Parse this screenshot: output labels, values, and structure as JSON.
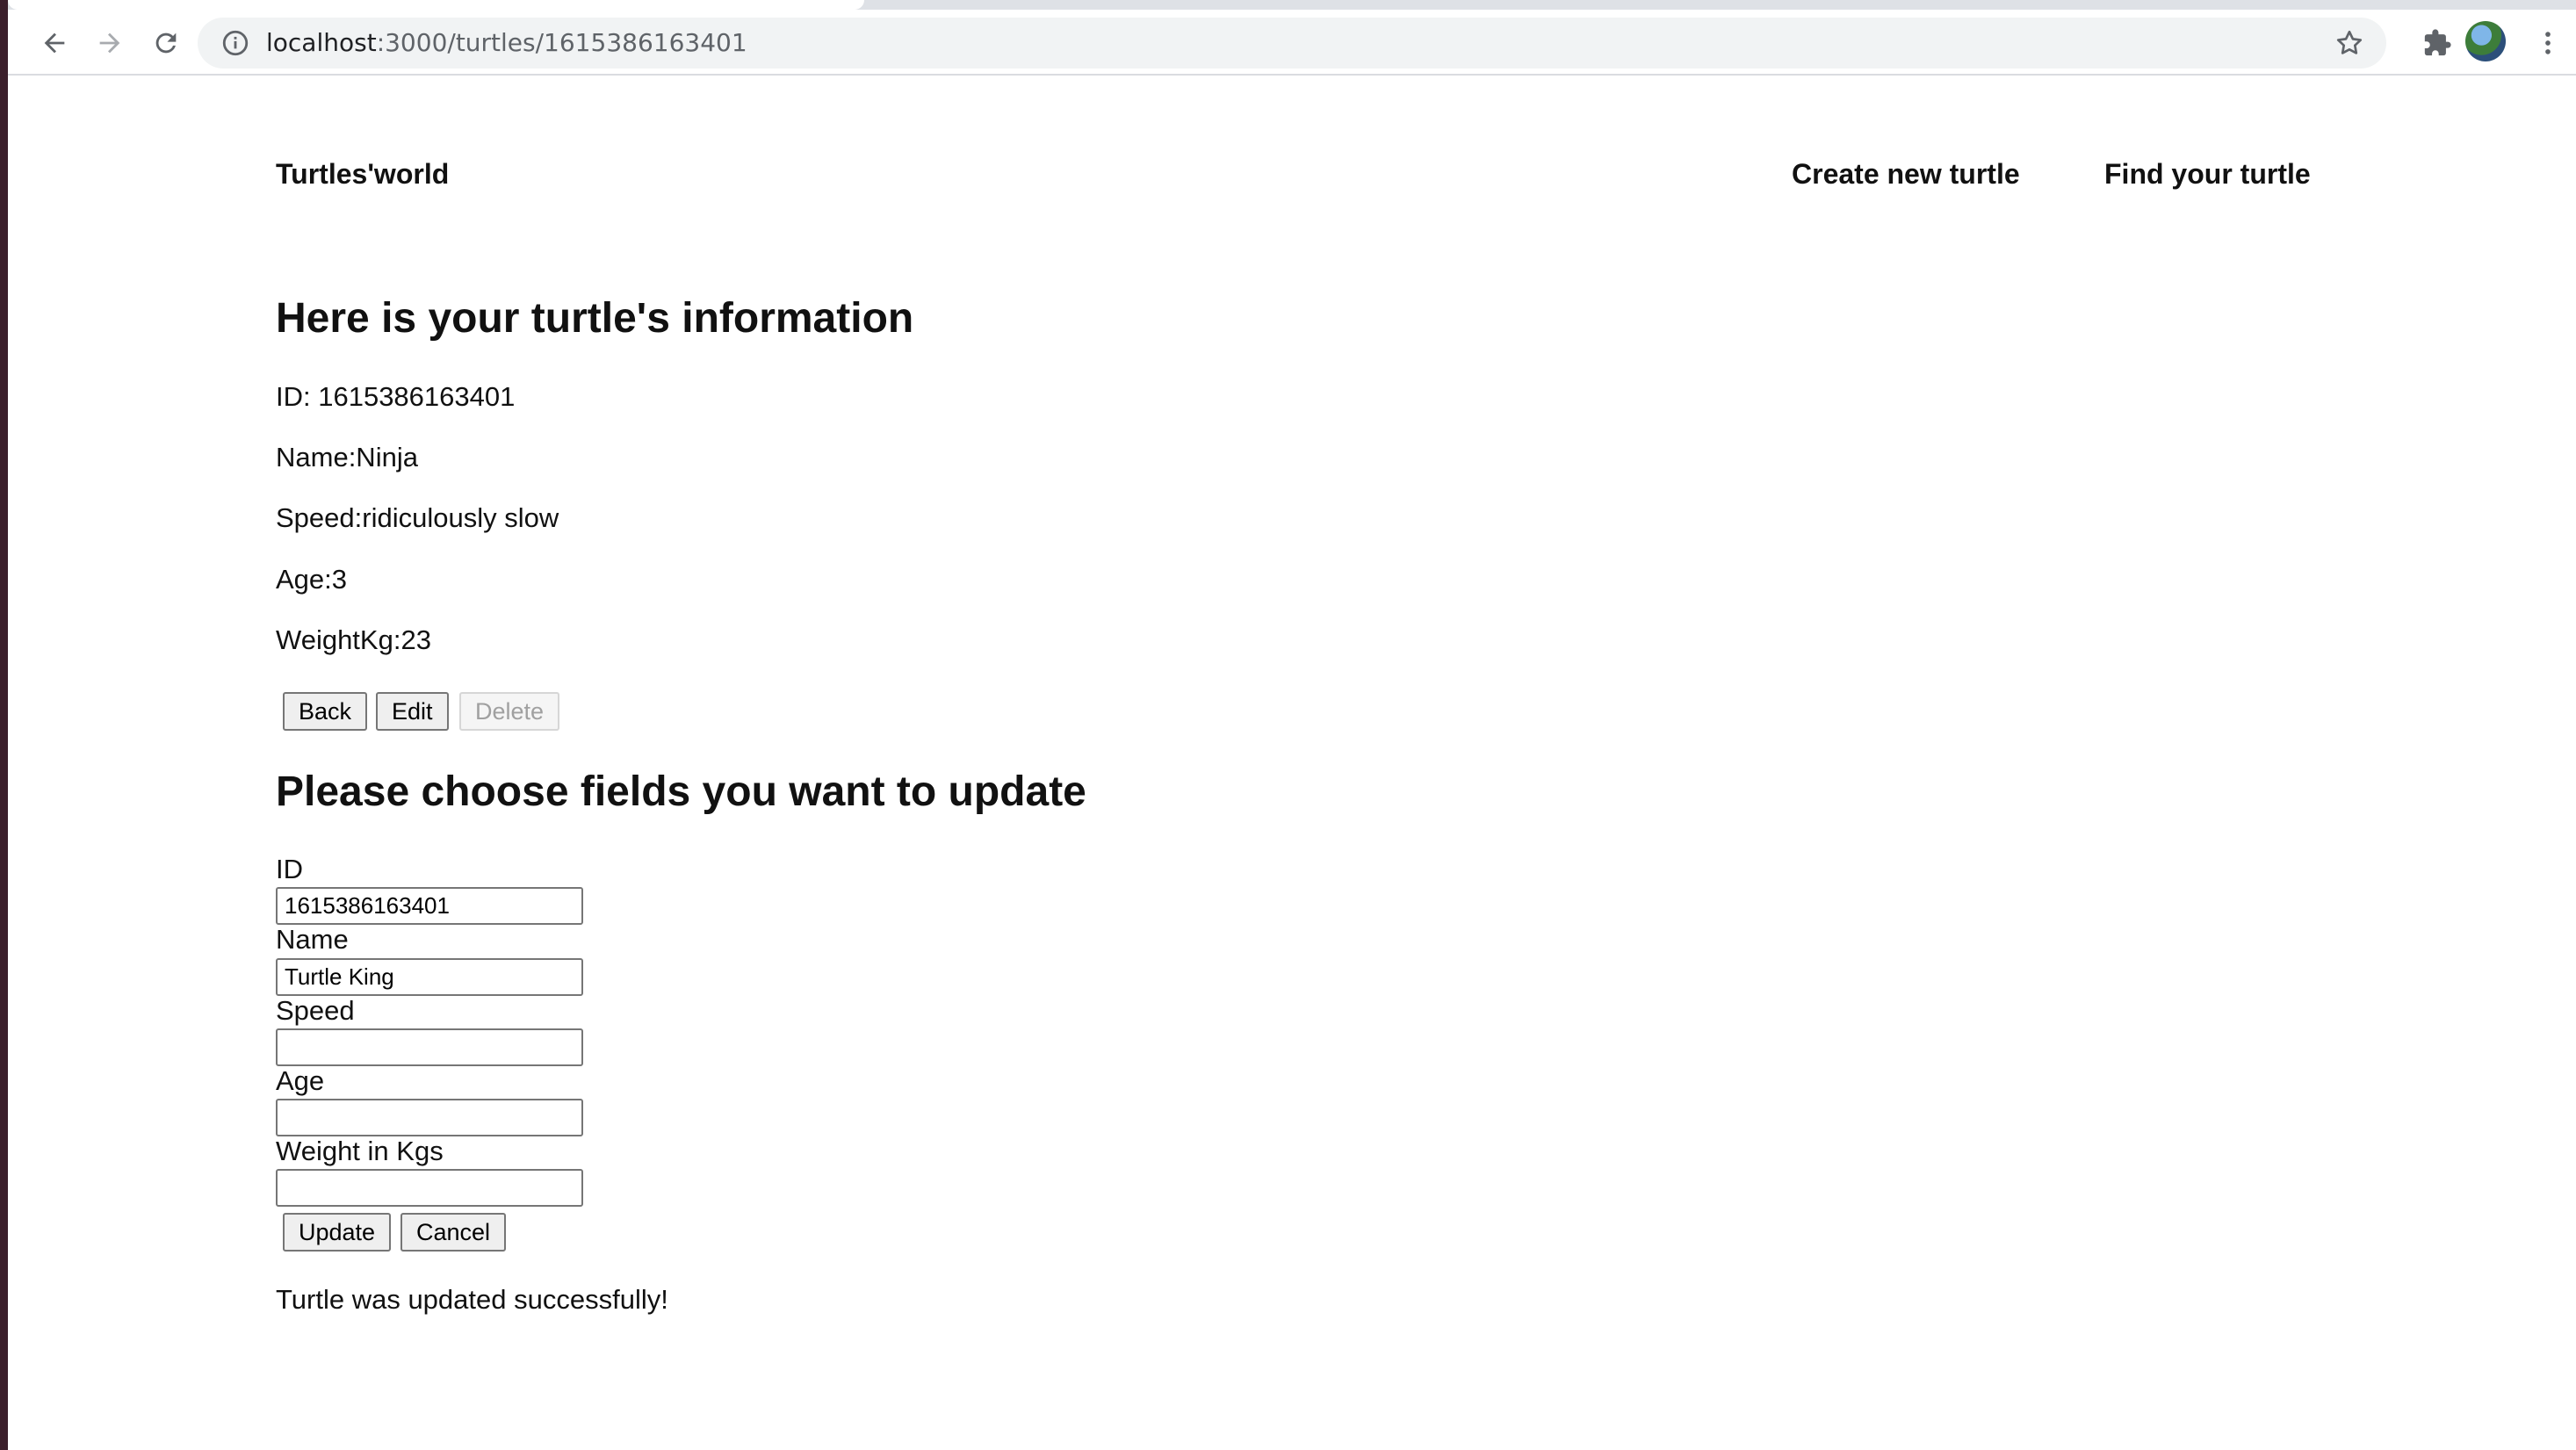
{
  "browser": {
    "url_host": "localhost",
    "url_path": ":3000/turtles/1615386163401"
  },
  "header": {
    "brand": "Turtles'world",
    "nav": {
      "create": "Create new turtle",
      "find": "Find your turtle"
    }
  },
  "info": {
    "title": "Here is your turtle's information",
    "id_line": "ID: 1615386163401",
    "name_line": "Name:Ninja",
    "speed_line": "Speed:ridiculously slow",
    "age_line": "Age:3",
    "weight_line": "WeightKg:23",
    "buttons": {
      "back": "Back",
      "edit": "Edit",
      "delete": "Delete"
    }
  },
  "update_form": {
    "title": "Please choose fields you want to update",
    "fields": {
      "id": {
        "label": "ID",
        "value": "1615386163401"
      },
      "name": {
        "label": "Name",
        "value": "Turtle King"
      },
      "speed": {
        "label": "Speed",
        "value": ""
      },
      "age": {
        "label": "Age",
        "value": ""
      },
      "weight": {
        "label": "Weight in Kgs",
        "value": ""
      }
    },
    "buttons": {
      "update": "Update",
      "cancel": "Cancel"
    }
  },
  "status": {
    "message": "Turtle was updated successfully!"
  },
  "colors": {
    "chrome_bg": "#dee1e6",
    "omnibox_bg": "#f1f3f4",
    "text": "#111111",
    "disabled_text": "#a0a0a0"
  }
}
